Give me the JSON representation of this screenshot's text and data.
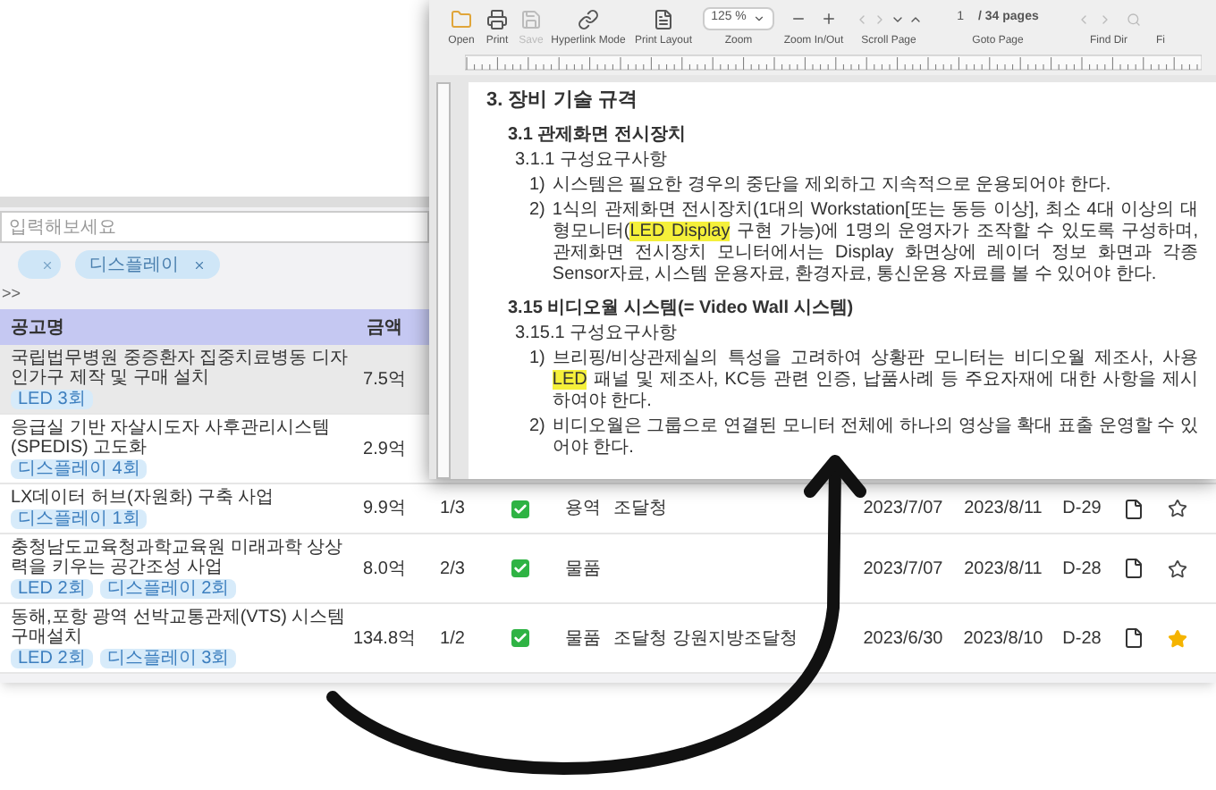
{
  "list_window": {
    "search": {
      "placeholder": "입력해보세요"
    },
    "filter_chips": [
      {
        "label": "디스플레이"
      }
    ],
    "nav_text": ">>",
    "table": {
      "columns": [
        "공고명",
        "금액"
      ],
      "rows": [
        {
          "selected": true,
          "title": "국립법무병원 중증환자 집중치료병동 디자인가구 제작 및 구매 설치",
          "tags": [
            "LED 3회"
          ],
          "amount": "7.5억"
        },
        {
          "selected": false,
          "title": "응급실 기반 자살시도자 사후관리시스템(SPEDIS) 고도화",
          "tags": [
            "디스플레이 4회"
          ],
          "amount": "2.9억"
        },
        {
          "selected": false,
          "title": "LX데이터 허브(자원화) 구축 사업",
          "tags": [
            "디스플레이 1회"
          ],
          "amount": "9.9억",
          "holding": "1/3",
          "checked": true,
          "type": "용역",
          "agency": "조달청",
          "start": "2023/7/07",
          "end": "2023/8/11",
          "dday": "D-29",
          "starred": false
        },
        {
          "selected": false,
          "title": "충청남도교육청과학교육원 미래과학 상상력을 키우는 공간조성 사업",
          "tags": [
            "LED 2회",
            "디스플레이 2회"
          ],
          "amount": "8.0억",
          "holding": "2/3",
          "checked": true,
          "type": "물품",
          "agency": "",
          "start": "2023/7/07",
          "end": "2023/8/11",
          "dday": "D-28",
          "starred": false
        },
        {
          "selected": false,
          "title": "동해,포항 광역 선박교통관제(VTS) 시스템 구매설치",
          "tags": [
            "LED 2회",
            "디스플레이 3회"
          ],
          "amount": "134.8억",
          "holding": "1/2",
          "checked": true,
          "type": "물품",
          "agency": "조달청 강원지방조달청",
          "start": "2023/6/30",
          "end": "2023/8/10",
          "dday": "D-28",
          "starred": true
        }
      ]
    }
  },
  "doc_window": {
    "toolbar": [
      {
        "kind": "open",
        "label": "Open",
        "disabled": false
      },
      {
        "kind": "print",
        "label": "Print",
        "disabled": false
      },
      {
        "kind": "save",
        "label": "Save",
        "disabled": true
      },
      {
        "kind": "hyperlink",
        "label": "Hyperlink Mode",
        "disabled": false
      },
      {
        "kind": "layout",
        "label": "Print Layout",
        "disabled": false
      },
      {
        "kind": "zoom",
        "label": "Zoom",
        "value": "125 %",
        "disabled": false
      },
      {
        "kind": "zoomio",
        "label": "Zoom In/Out",
        "disabled": false
      },
      {
        "kind": "scroll",
        "label": "Scroll Page",
        "disabled": false
      },
      {
        "kind": "goto",
        "label": "Goto Page",
        "value": "1",
        "total": "/ 34 pages",
        "disabled": false
      },
      {
        "kind": "find",
        "label": "Find Dir",
        "disabled": false
      },
      {
        "kind": "cut",
        "label": "Fi",
        "disabled": false
      }
    ],
    "document": [
      {
        "kind": "h1",
        "text": "3. 장비 기술 규격"
      },
      {
        "kind": "h2",
        "text": "3.1 관제화면 전시장치"
      },
      {
        "kind": "h3",
        "text": "3.1.1 구성요구사항"
      },
      {
        "kind": "item",
        "num": "1)",
        "segments": [
          {
            "text": "시스템은 필요한 경우의 중단을 제외하고 지속적으로 운용되어야 한다.",
            "highlight": false
          }
        ]
      },
      {
        "kind": "item",
        "num": "2)",
        "segments": [
          {
            "text": "1식의 관제화면 전시장치(1대의 Workstation[또는 동등 이상], 최소 4대 이상의 대형모니터(",
            "highlight": false
          },
          {
            "text": "LED Display",
            "highlight": true
          },
          {
            "text": " 구현 가능)에 1명의 운영자가 조작할 수 있도록 구성하며, 관제화면 전시장치 모니터에서는 Display 화면상에 레이더 정보 화면과 각종 Sensor자료, 시스템 운용자료, 환경자료, 통신운용 자료를 볼 수 있어야 한다.",
            "highlight": false
          }
        ]
      },
      {
        "kind": "h2",
        "text": "3.15 비디오월 시스템(= Video Wall 시스템)"
      },
      {
        "kind": "h3",
        "text": "3.15.1 구성요구사항"
      },
      {
        "kind": "item",
        "num": "1)",
        "segments": [
          {
            "text": "브리핑/비상관제실의 특성을 고려하여 상황판 모니터는 비디오월 제조사, 사용 ",
            "highlight": false
          },
          {
            "text": "LED",
            "highlight": true
          },
          {
            "text": " 패널 및 제조사, KC등 관련 인증, 납품사례 등 주요자재에 대한 사항을 제시하여야 한다.",
            "highlight": false
          }
        ]
      },
      {
        "kind": "item",
        "num": "2)",
        "segments": [
          {
            "text": "비디오월은 그룹으로 연결된 모니터 전체에 하나의 영상을 확대 표출 운영할 수 있어야 한다.",
            "highlight": false
          }
        ]
      }
    ]
  }
}
